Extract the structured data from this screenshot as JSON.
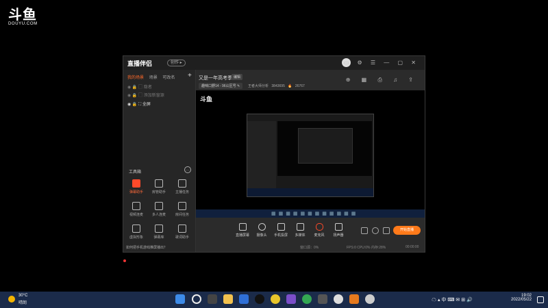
{
  "watermark": {
    "logo": "斗鱼",
    "sub": "DOUYU.COM"
  },
  "app": {
    "brand": "直播伴侣",
    "badge": "创作 ▸",
    "left_tabs": [
      "我的场景",
      "场景",
      "可改名"
    ],
    "scenes": [
      {
        "label": "隐者",
        "active": false
      },
      {
        "label": "添加新窗源",
        "active": false
      },
      {
        "label": "全屏",
        "active": true
      }
    ],
    "tools_title": "工具箱",
    "tools": [
      {
        "label": "弹幕助手",
        "red": true
      },
      {
        "label": "房管助手",
        "red": false
      },
      {
        "label": "主播任务",
        "red": false
      },
      {
        "label": "视频连麦",
        "red": false
      },
      {
        "label": "多人连麦",
        "red": false
      },
      {
        "label": "房间任务",
        "red": false
      },
      {
        "label": "虚拟形象",
        "red": false
      },
      {
        "label": "弹幕库",
        "red": false
      },
      {
        "label": "歌词助手",
        "red": false
      }
    ],
    "tip": "如何把手机游戏推屏播出？",
    "room": {
      "title": "又是一年高考季",
      "tag": "编辑",
      "category": "趣味口野14 - 96公区号 ✎",
      "stats": "王者大师分析 3843695  🔥 26767"
    },
    "preview_logo": "斗鱼",
    "controls": [
      {
        "label": "直播屏幕"
      },
      {
        "label": "摄像头"
      },
      {
        "label": "手机投屏"
      },
      {
        "label": "多媒体"
      },
      {
        "label": "麦克风"
      },
      {
        "label": "扬声器"
      }
    ],
    "go_live": "开始直播",
    "status": {
      "left": "窗口源：0%",
      "mid": "FPS:0   CPU:0%   内存:28%",
      "right": "00:00:00"
    }
  },
  "taskbar": {
    "weather_temp": "30°C",
    "weather_desc": "晴朗",
    "tray_lang": "中",
    "time": "19:02",
    "date": "2022/05/22"
  }
}
